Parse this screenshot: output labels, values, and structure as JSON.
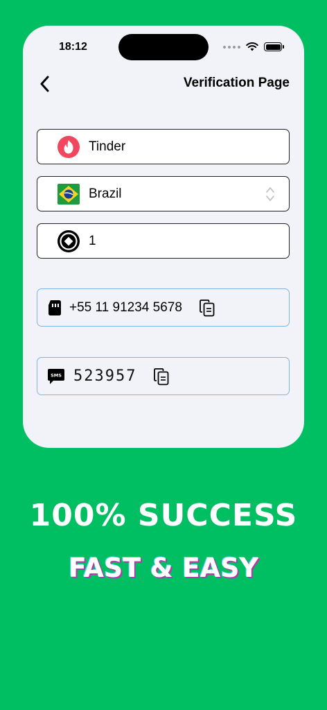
{
  "status_bar": {
    "time": "18:12"
  },
  "header": {
    "title": "Verification Page"
  },
  "fields": {
    "service": {
      "label": "Tinder",
      "icon": "tinder-flame-icon"
    },
    "country": {
      "label": "Brazil",
      "icon": "brazil-flag-icon"
    },
    "quantity": {
      "label": "1",
      "icon": "coin-icon"
    }
  },
  "phone_number": {
    "value": "+55 11 91234 5678",
    "icon": "sim-card-icon"
  },
  "sms_code": {
    "value": "523957",
    "icon": "sms-icon"
  },
  "promo": {
    "line1": "100% SUCCESS",
    "line2": "FAST & EASY"
  },
  "colors": {
    "background": "#00BF63",
    "card": "#F2F3F8",
    "copy_border": "#7FB3E4",
    "tinder": "#F0475E"
  }
}
